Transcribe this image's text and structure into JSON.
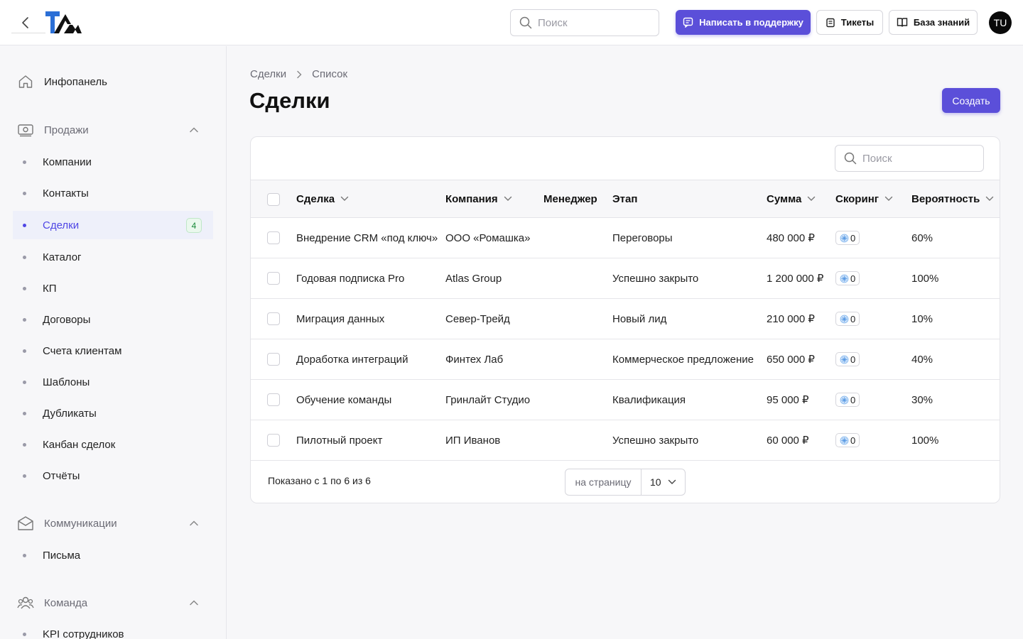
{
  "header": {
    "search_placeholder": "Поиск",
    "support_button": "Написать в поддержку",
    "tickets_button": "Тикеты",
    "knowledge_base_button": "База знаний",
    "avatar_initials": "TU",
    "accent_color": "#5b4fd9"
  },
  "sidebar": {
    "dashboard": "Инфопанель",
    "sales": {
      "label": "Продажи",
      "items": [
        {
          "label": "Компании"
        },
        {
          "label": "Контакты"
        },
        {
          "label": "Сделки",
          "badge": "4",
          "active": true
        },
        {
          "label": "Каталог"
        },
        {
          "label": "КП"
        },
        {
          "label": "Договоры"
        },
        {
          "label": "Счета клиентам"
        },
        {
          "label": "Шаблоны"
        },
        {
          "label": "Дубликаты"
        },
        {
          "label": "Канбан сделок"
        },
        {
          "label": "Отчёты"
        }
      ]
    },
    "communications": {
      "label": "Коммуникации",
      "items": [
        {
          "label": "Письма"
        }
      ]
    },
    "team": {
      "label": "Команда",
      "items": [
        {
          "label": "KPI сотрудников"
        }
      ]
    }
  },
  "breadcrumb": {
    "root": "Сделки",
    "current": "Список"
  },
  "page": {
    "title": "Сделки",
    "create_button": "Создать"
  },
  "table": {
    "search_placeholder": "Поиск",
    "columns": {
      "deal": "Сделка",
      "company": "Компания",
      "manager": "Менеджер",
      "stage": "Этап",
      "amount": "Сумма",
      "scoring": "Скоринг",
      "probability": "Вероятность"
    },
    "rows": [
      {
        "deal": "Внедрение CRM «под ключ»",
        "company": "ООО «Ромашка»",
        "manager": "",
        "stage": "Переговоры",
        "amount": "480 000 ₽",
        "score": "0",
        "probability": "60%"
      },
      {
        "deal": "Годовая подписка Pro",
        "company": "Atlas Group",
        "manager": "",
        "stage": "Успешно закрыто",
        "amount": "1 200 000 ₽",
        "score": "0",
        "probability": "100%"
      },
      {
        "deal": "Миграция данных",
        "company": "Север-Трейд",
        "manager": "",
        "stage": "Новый лид",
        "amount": "210 000 ₽",
        "score": "0",
        "probability": "10%"
      },
      {
        "deal": "Доработка интеграций",
        "company": "Финтех Лаб",
        "manager": "",
        "stage": "Коммерческое предложение",
        "amount": "650 000 ₽",
        "score": "0",
        "probability": "40%"
      },
      {
        "deal": "Обучение команды",
        "company": "Гринлайт Студио",
        "manager": "",
        "stage": "Квалификация",
        "amount": "95 000 ₽",
        "score": "0",
        "probability": "30%"
      },
      {
        "deal": "Пилотный проект",
        "company": "ИП Иванов",
        "manager": "",
        "stage": "Успешно закрыто",
        "amount": "60 000 ₽",
        "score": "0",
        "probability": "100%"
      }
    ],
    "footer": {
      "shown": "Показано с 1 по 6 из 6",
      "per_page_label": "на страницу",
      "per_page_value": "10"
    }
  }
}
